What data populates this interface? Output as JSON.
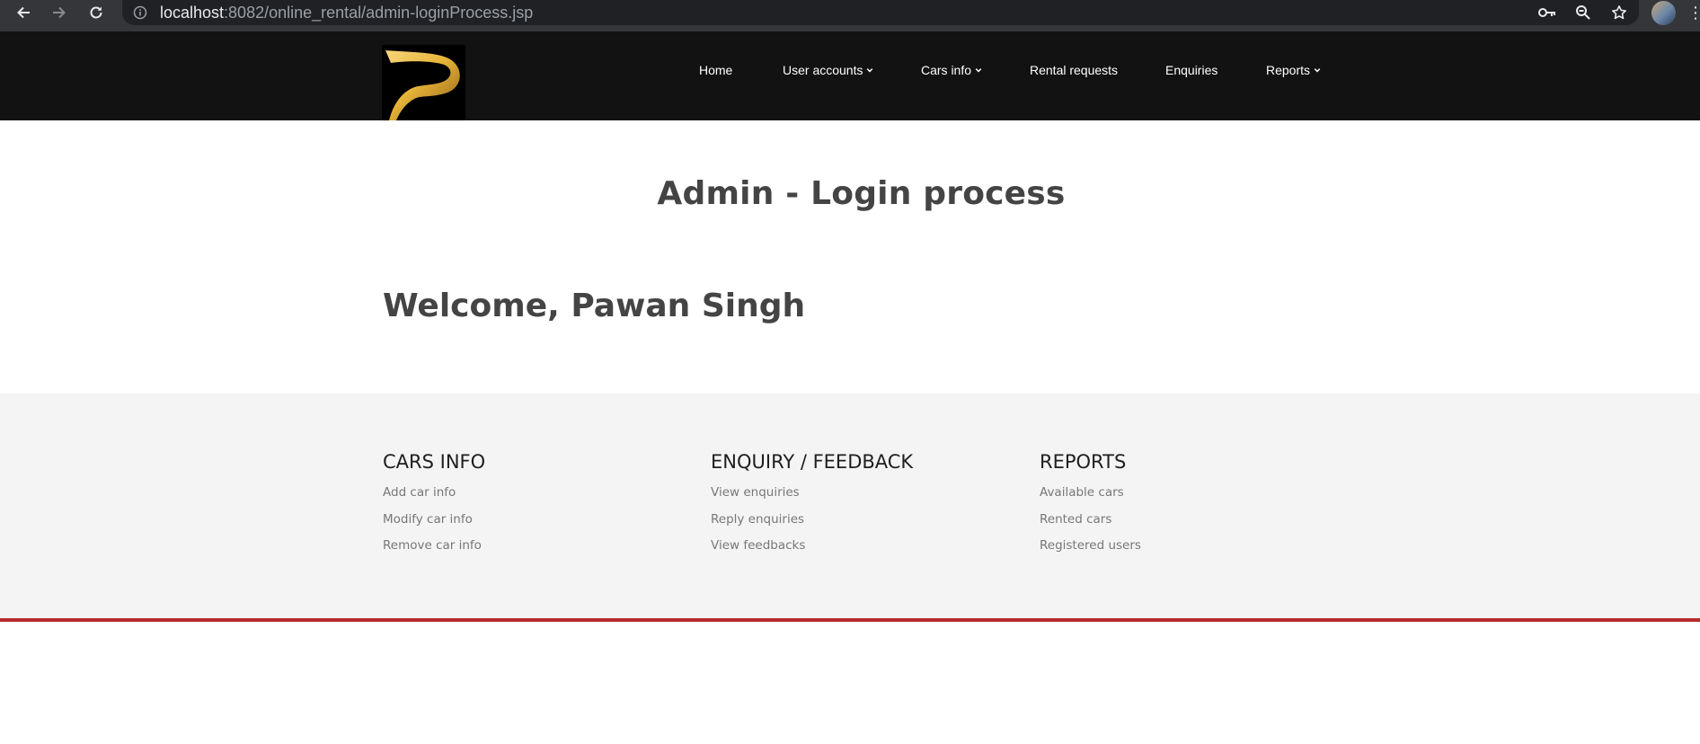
{
  "browser": {
    "url_host": "localhost",
    "url_rest": ":8082/online_rental/admin-loginProcess.jsp"
  },
  "nav": {
    "items": [
      {
        "label": "Home",
        "has_dropdown": false
      },
      {
        "label": "User accounts",
        "has_dropdown": true
      },
      {
        "label": "Cars info",
        "has_dropdown": true
      },
      {
        "label": "Rental requests",
        "has_dropdown": false
      },
      {
        "label": "Enquiries",
        "has_dropdown": false
      },
      {
        "label": "Reports",
        "has_dropdown": true
      }
    ]
  },
  "main": {
    "title": "Admin - Login process",
    "welcome": "Welcome, Pawan Singh"
  },
  "footer": {
    "columns": [
      {
        "heading": "CARS INFO",
        "links": [
          "Add car info",
          "Modify car info",
          "Remove car info"
        ]
      },
      {
        "heading": "ENQUIRY / FEEDBACK",
        "links": [
          "View enquiries",
          "Reply enquiries",
          "View feedbacks"
        ]
      },
      {
        "heading": "REPORTS",
        "links": [
          "Available cars",
          "Rented cars",
          "Registered users"
        ]
      }
    ]
  },
  "colors": {
    "header_bg": "#121212",
    "footer_bg": "#f4f4f4",
    "accent_rule": "#b72b2b",
    "logo_gold": "#e8b53a"
  },
  "icons": [
    "back-icon",
    "forward-icon",
    "reload-icon",
    "info-icon",
    "key-icon",
    "zoom-icon",
    "star-icon",
    "chevron-down-icon"
  ]
}
